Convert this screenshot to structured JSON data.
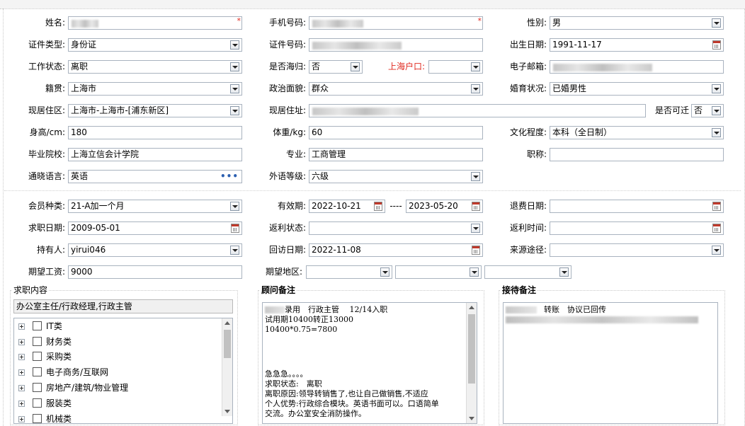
{
  "personal": {
    "name_label": "姓名:",
    "phone_label": "手机号码:",
    "gender_label": "性别:",
    "gender_value": "男",
    "id_type_label": "证件类型:",
    "id_type_value": "身份证",
    "id_number_label": "证件号码:",
    "birth_label": "出生日期:",
    "birth_value": "1991-11-17",
    "work_status_label": "工作状态:",
    "work_status_value": "离职",
    "returnee_label": "是否海归:",
    "returnee_value": "否",
    "hukou_label": "上海户口:",
    "email_label": "电子邮箱:",
    "origin_label": "籍贯:",
    "origin_value": "上海市",
    "politics_label": "政治面貌:",
    "politics_value": "群众",
    "marital_label": "婚育状况:",
    "marital_value": "已婚男性",
    "residence_area_label": "现居住区:",
    "residence_area_value": "上海市-上海市-[浦东新区]",
    "address_label": "现居住址:",
    "relocate_label": "是否可迁",
    "relocate_value": "否",
    "height_label": "身高/cm:",
    "height_value": "180",
    "weight_label": "体重/kg:",
    "weight_value": "60",
    "education_label": "文化程度:",
    "education_value": "本科（全日制）",
    "school_label": "毕业院校:",
    "school_value": "上海立信会计学院",
    "major_label": "专业:",
    "major_value": "工商管理",
    "title_label": "职称:",
    "language_label": "通晓语言:",
    "language_value": "英语",
    "foreign_level_label": "外语等级:",
    "foreign_level_value": "六级",
    "required_mark": "*",
    "more_glyph": "•••"
  },
  "membership": {
    "member_type_label": "会员种类:",
    "member_type_value": "21-A加一个月",
    "valid_label": "有效期:",
    "valid_from": "2022-10-21",
    "valid_sep": "----",
    "valid_to": "2023-05-20",
    "refund_date_label": "退费日期:",
    "job_date_label": "求职日期:",
    "job_date_value": "2009-05-01",
    "rebate_status_label": "返利状态:",
    "rebate_time_label": "返利时间:",
    "holder_label": "持有人:",
    "holder_value": "yirui046",
    "visit_date_label": "回访日期:",
    "visit_date_value": "2022-11-08",
    "source_label": "来源途径:",
    "salary_label": "期望工资:",
    "salary_value": "9000",
    "region_label": "期望地区:"
  },
  "job_content": {
    "title": "求职内容",
    "summary": "办公室主任/行政经理,行政主管",
    "categories": [
      "IT类",
      "财务类",
      "采购类",
      "电子商务/互联网",
      "房地产/建筑/物业管理",
      "服装类",
      "机械类"
    ]
  },
  "advisor_notes": {
    "title": "顾问备注",
    "lines": [
      "录用　行政主管　 12/14入职",
      "试用期10400转正13000",
      "10400*0.75=7800",
      "",
      "",
      "",
      "急急急。。。。",
      "求职状态:　离职",
      "离职原因:领导转销售了,也让自己做销售,不适应",
      "个人优势:行政综合模块。英语书面可以。口语简单",
      "交流。办公室安全消防操作。"
    ]
  },
  "reception_notes": {
    "title": "接待备注",
    "line1": "转账　协议已回传"
  },
  "colors": {
    "border": "#a9b3bf",
    "required": "#e0281e",
    "link_dots": "#2b5fb0"
  }
}
